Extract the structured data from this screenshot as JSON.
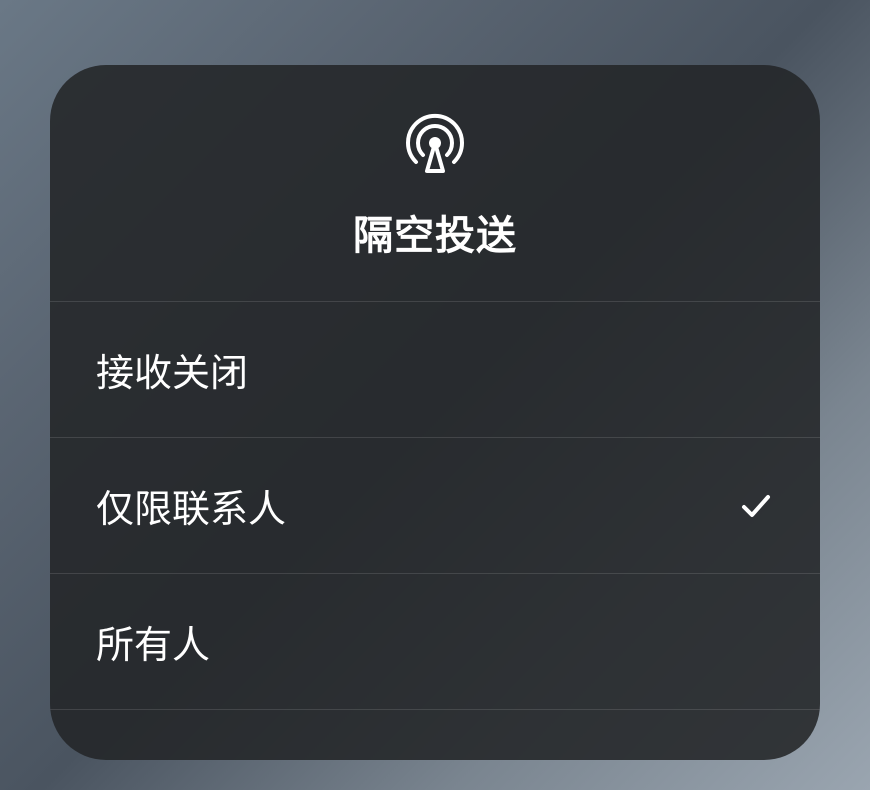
{
  "panel": {
    "title": "隔空投送",
    "icon": "airdrop-icon",
    "options": [
      {
        "label": "接收关闭",
        "selected": false
      },
      {
        "label": "仅限联系人",
        "selected": true
      },
      {
        "label": "所有人",
        "selected": false
      }
    ]
  }
}
